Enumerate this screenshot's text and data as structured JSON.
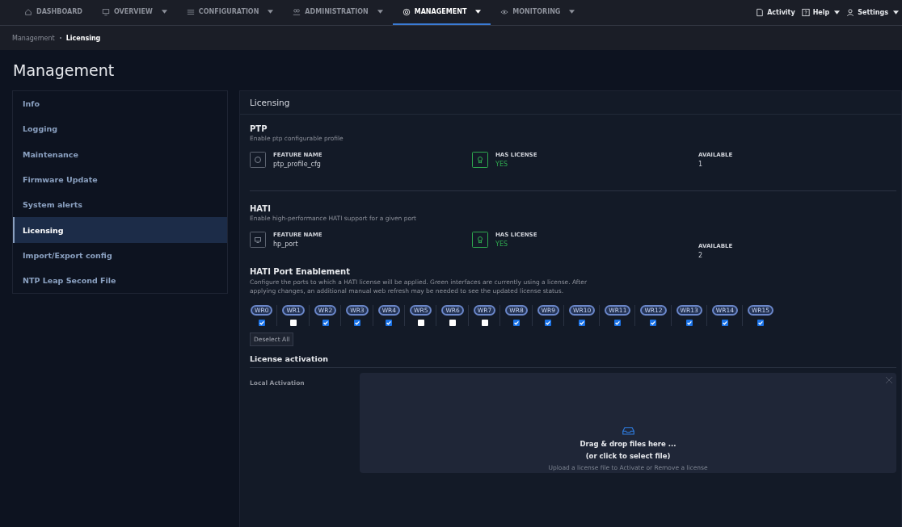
{
  "nav": {
    "items": [
      {
        "label": "DASHBOARD",
        "dropdown": false,
        "selected": false
      },
      {
        "label": "OVERVIEW",
        "dropdown": true,
        "selected": false
      },
      {
        "label": "CONFIGURATION",
        "dropdown": true,
        "selected": false
      },
      {
        "label": "ADMINISTRATION",
        "dropdown": true,
        "selected": false
      },
      {
        "label": "MANAGEMENT",
        "dropdown": true,
        "selected": true
      },
      {
        "label": "MONITORING",
        "dropdown": true,
        "selected": false
      }
    ],
    "right": [
      {
        "label": "Activity",
        "dropdown": false
      },
      {
        "label": "Help",
        "dropdown": true
      },
      {
        "label": "Settings",
        "dropdown": true
      }
    ]
  },
  "breadcrumb": [
    "Management",
    "Licensing"
  ],
  "page_title": "Management",
  "sidebar": {
    "items": [
      {
        "label": "Info",
        "selected": false
      },
      {
        "label": "Logging",
        "selected": false
      },
      {
        "label": "Maintenance",
        "selected": false
      },
      {
        "label": "Firmware Update",
        "selected": false
      },
      {
        "label": "System alerts",
        "selected": false
      },
      {
        "label": "Licensing",
        "selected": true
      },
      {
        "label": "Import/Export config",
        "selected": false
      },
      {
        "label": "NTP Leap Second File",
        "selected": false
      }
    ]
  },
  "panel_title": "Licensing",
  "features": [
    {
      "title": "PTP",
      "description": "Enable ptp configurable profile",
      "feature_name_label": "FEATURE NAME",
      "feature_name": "ptp_profile_cfg",
      "has_license_label": "HAS LICENSE",
      "has_license": "YES",
      "licensed": true,
      "available_label": "AVAILABLE",
      "available": "1"
    },
    {
      "title": "HATI",
      "description": "Enable high-performance HATI support for a given port",
      "feature_name_label": "FEATURE NAME",
      "feature_name": "hp_port",
      "has_license_label": "HAS LICENSE",
      "has_license": "YES",
      "licensed": true,
      "available_label": "AVAILABLE",
      "available": "2"
    }
  ],
  "port_enablement": {
    "title": "HATI Port Enablement",
    "description": "Configure the ports to which a HATI license will be applied. Green interfaces are currently using a license. After applying changes, an additional manual web refresh may be needed to see the updated license status.",
    "ports": [
      {
        "label": "WR0",
        "checked": true
      },
      {
        "label": "WR1",
        "checked": false
      },
      {
        "label": "WR2",
        "checked": true
      },
      {
        "label": "WR3",
        "checked": true
      },
      {
        "label": "WR4",
        "checked": true
      },
      {
        "label": "WR5",
        "checked": false
      },
      {
        "label": "WR6",
        "checked": false
      },
      {
        "label": "WR7",
        "checked": false
      },
      {
        "label": "WR8",
        "checked": true
      },
      {
        "label": "WR9",
        "checked": true
      },
      {
        "label": "WR10",
        "checked": true
      },
      {
        "label": "WR11",
        "checked": true
      },
      {
        "label": "WR12",
        "checked": true
      },
      {
        "label": "WR13",
        "checked": true
      },
      {
        "label": "WR14",
        "checked": true
      },
      {
        "label": "WR15",
        "checked": true
      }
    ],
    "deselect_button": "Deselect All"
  },
  "activation": {
    "title": "License activation",
    "local_label": "Local Activation",
    "drop_title": "Drag & drop files here ...",
    "drop_subtitle": "(or click to select file)",
    "drop_hint": "Upload a license file to Activate or Remove a license"
  }
}
